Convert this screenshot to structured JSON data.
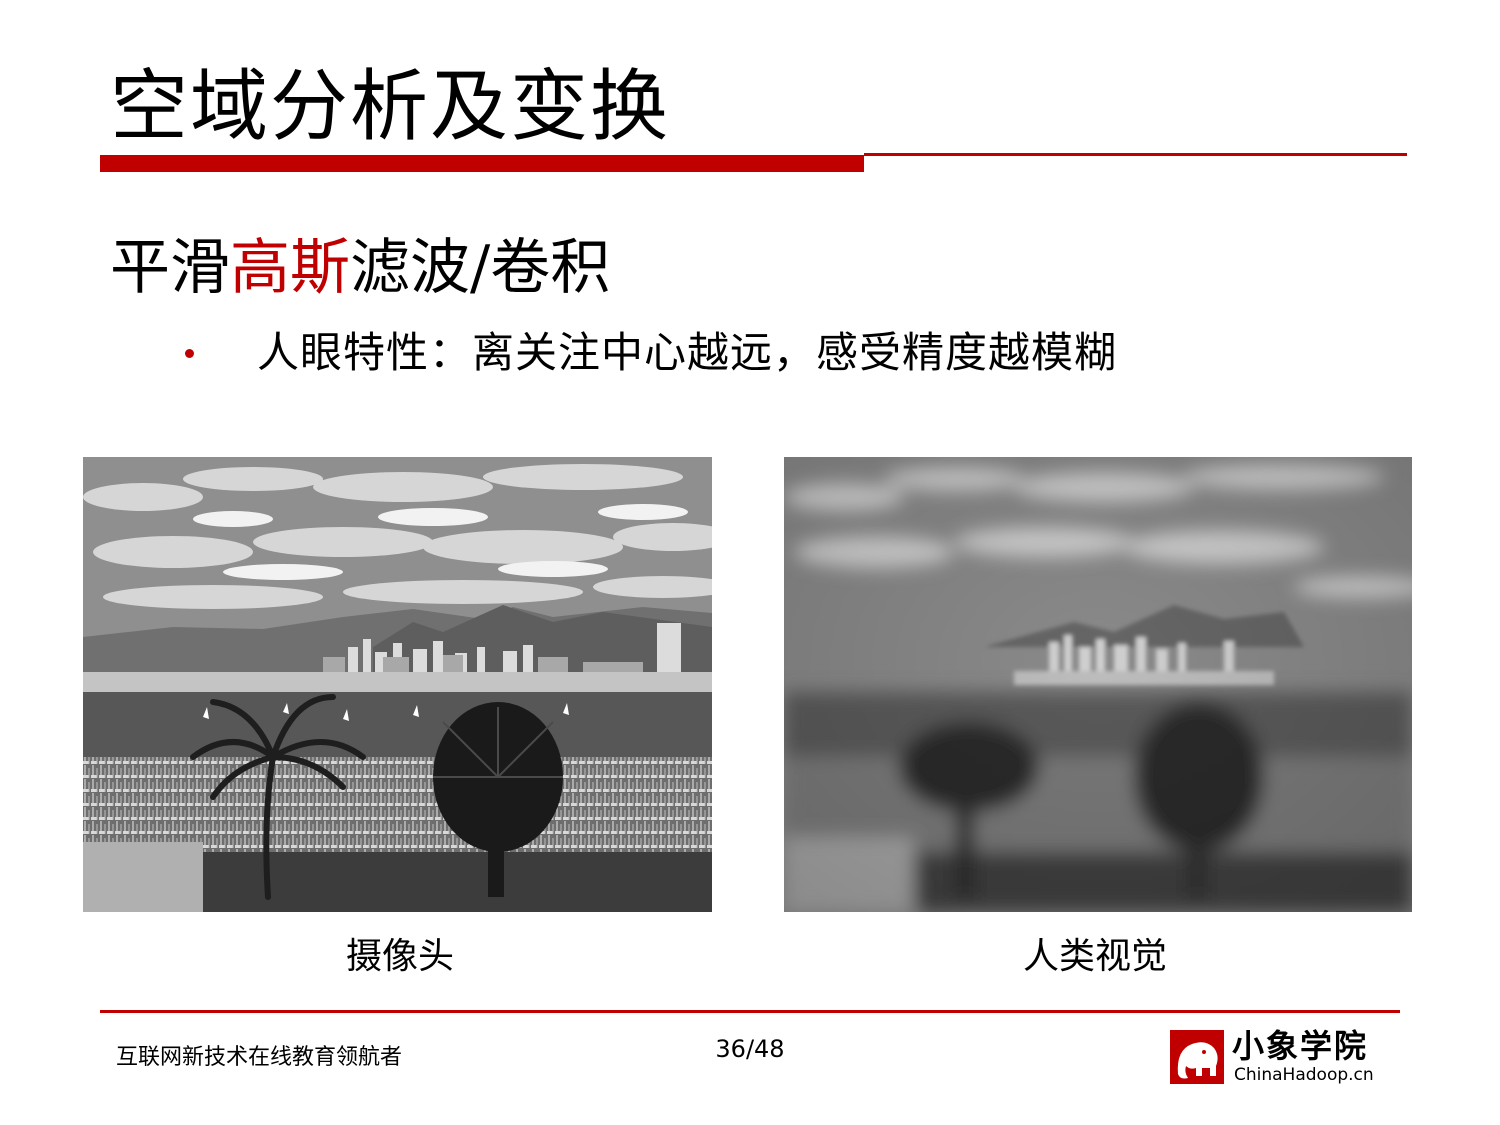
{
  "slide": {
    "title": "空域分析及变换",
    "heading_prefix": "平滑",
    "heading_accent": "高斯",
    "heading_suffix": "滤波/卷积",
    "bullet": "人眼特性：离关注中心越远，感受精度越模糊"
  },
  "images": [
    {
      "caption": "摄像头",
      "style": "sharp"
    },
    {
      "caption": "人类视觉",
      "style": "blurred-periphery"
    }
  ],
  "footer": {
    "tagline": "互联网新技术在线教育领航者",
    "page": "36/48",
    "logo_name": "小象学院",
    "logo_url": "ChinaHadoop.cn"
  },
  "colors": {
    "accent": "#c00000",
    "text": "#000000"
  }
}
